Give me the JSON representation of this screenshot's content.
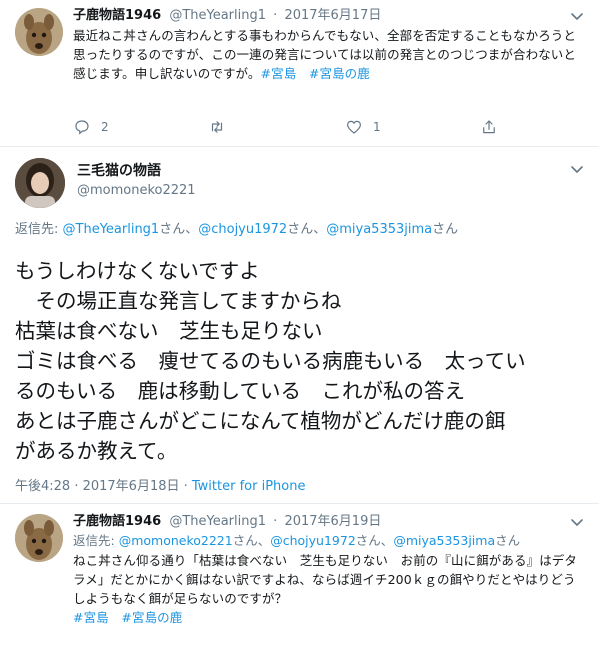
{
  "colors": {
    "link": "#1b95e0",
    "secondary_text": "#657786",
    "primary_text": "#14171a",
    "divider": "#e6ecf0"
  },
  "top_tweet": {
    "display_name": "子鹿物語1946",
    "handle": "@TheYearling1",
    "separator": "·",
    "date": "2017年6月17日",
    "text": "最近ねこ丼さんの言わんとする事もわからんでもない、全部を否定することもなかろうと思ったりするのですが、この一連の発言については以前の発言とのつじつまが合わないと感じます。申し訳ないのですが。",
    "hashtags": [
      "#宮島",
      "#宮島の鹿"
    ],
    "reply_count": "2",
    "like_count": "1",
    "icons": [
      "chevron-down-icon",
      "reply-icon",
      "retweet-icon",
      "like-icon",
      "share-icon"
    ]
  },
  "main_tweet": {
    "display_name": "三毛猫の物語",
    "handle": "@momoneko2221",
    "reply_to": {
      "prefix": "返信先: ",
      "mentions": [
        "@TheYearling1",
        "@chojyu1972",
        "@miya5353jima"
      ],
      "suffix": "さん",
      "sep": "、"
    },
    "text_lines": [
      "もうしわけなくないですよ",
      "　その場正直な発言してますからね",
      "枯葉は食べない　芝生も足りない",
      "ゴミは食べる　痩せてるのもいる病鹿もいる　太ってい",
      "るのもいる　鹿は移動している　これが私の答え",
      "あとは子鹿さんがどこになんて植物がどんだけ鹿の餌",
      "があるか教えて。"
    ],
    "timestamp": "午後4:28 · 2017年6月18日 · ",
    "client": "Twitter for iPhone"
  },
  "bottom_tweet": {
    "display_name": "子鹿物語1946",
    "handle": "@TheYearling1",
    "separator": "·",
    "date": "2017年6月19日",
    "reply_to": {
      "prefix": "返信先: ",
      "mentions": [
        "@momoneko2221",
        "@chojyu1972",
        "@miya5353jima"
      ],
      "suffix": "さん",
      "sep": "、"
    },
    "text": "ねこ丼さん仰る通り「枯葉は食べない　芝生も足りない　お前の『山に餌がある』はデタラメ」だとかにかく餌はない訳ですよね、ならば週イチ200ｋｇの餌やりだとやはりどうしようもなく餌が足らないのですが？",
    "hashtags": [
      "#宮島",
      "#宮島の鹿"
    ]
  }
}
